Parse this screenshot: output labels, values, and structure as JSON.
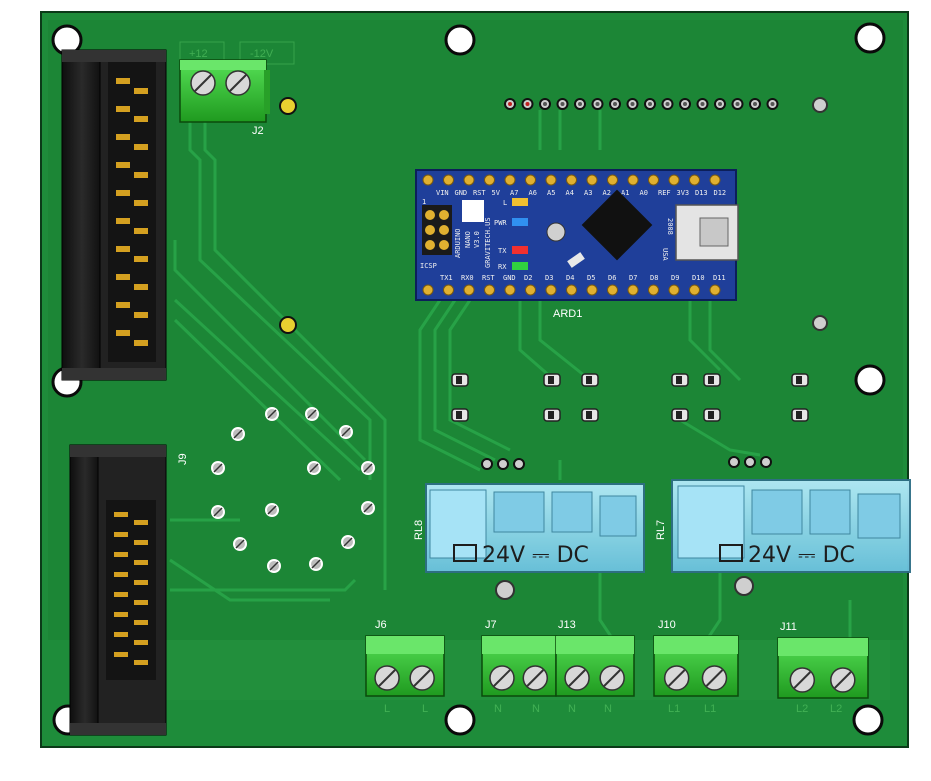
{
  "board": {
    "colors": {
      "pcb": "#1e8c3a",
      "pcb_edge": "#157a30",
      "trace": "#27a445",
      "terminal": "#32c832",
      "header": "#1a1a1a",
      "arduino": "#1f3f9a",
      "relay": "#8fd6ee",
      "hole": "#ffffff"
    }
  },
  "labels": {
    "j2": "J2",
    "j9": "J9",
    "ard1": "ARD1",
    "rl8": "RL8",
    "rl7": "RL7",
    "j6": "J6",
    "j7": "J7",
    "j13": "J13",
    "j10": "J10",
    "j11": "J11"
  },
  "silk": {
    "plus12": "+12",
    "minus12": "-12V",
    "j6_a": "L",
    "j6_b": "L",
    "j7_a": "N",
    "j7_b": "N",
    "j13_a": "N",
    "j13_b": "N",
    "j10_a": "L1",
    "j10_b": "L1",
    "j11_a": "L2",
    "j11_b": "L2"
  },
  "relays": {
    "rl8_text": "24V ⎓ DC",
    "rl7_text": "24V ⎓ DC"
  },
  "arduino": {
    "brand": "ARDUINO",
    "model": "NANO",
    "version": "V3.0",
    "maker": "GRAVITECH.US",
    "year": "2008",
    "usa": "USA",
    "top_pins": [
      "D12",
      "D13",
      "3V3",
      "REF",
      "A0",
      "A1",
      "A2",
      "A3",
      "A4",
      "A5",
      "A6",
      "A7",
      "5V",
      "RST",
      "GND",
      "VIN"
    ],
    "bottom_pins": [
      "D11",
      "D10",
      "D9",
      "D8",
      "D7",
      "D6",
      "D5",
      "D4",
      "D3",
      "D2",
      "GND",
      "RST",
      "RX0",
      "TX1"
    ],
    "icsp": "ICSP",
    "led_pwr": "PWR",
    "led_l": "L",
    "led_tx": "TX",
    "led_rx": "RX",
    "one": "1"
  }
}
